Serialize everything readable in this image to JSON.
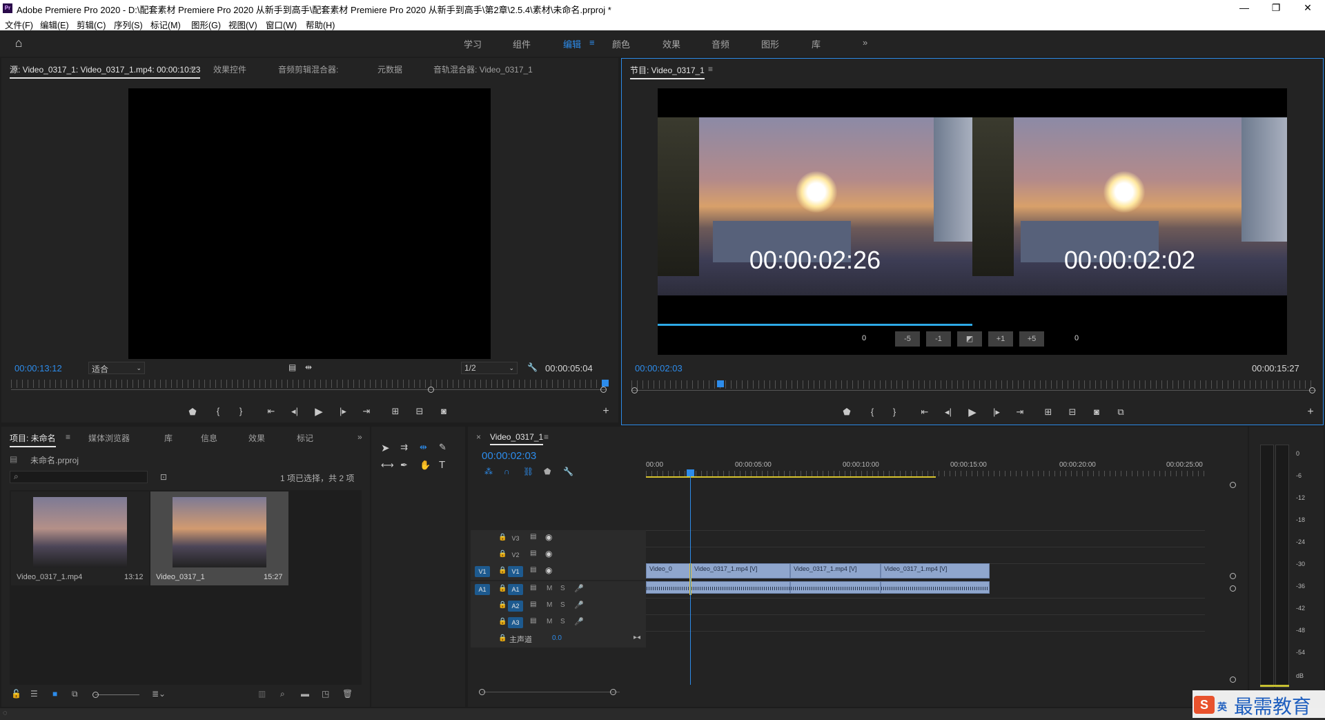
{
  "app": {
    "title": "Adobe Premiere Pro 2020 - D:\\配套素材 Premiere Pro 2020 从新手到高手\\配套素材 Premiere Pro 2020 从新手到高手\\第2章\\2.5.4\\素材\\未命名.prproj *",
    "logo": "Pr"
  },
  "window_controls": {
    "minimize": "—",
    "maximize": "❐",
    "close": "✕"
  },
  "menu": [
    "文件(F)",
    "编辑(E)",
    "剪辑(C)",
    "序列(S)",
    "标记(M)",
    "图形(G)",
    "视图(V)",
    "窗口(W)",
    "帮助(H)"
  ],
  "workspaces": {
    "items": [
      "学习",
      "组件",
      "编辑",
      "颜色",
      "效果",
      "音频",
      "图形",
      "库"
    ],
    "active": "编辑",
    "more": "»"
  },
  "source_panel": {
    "tabs": [
      "源: Video_0317_1: Video_0317_1.mp4: 00:00:10:23",
      "效果控件",
      "音频剪辑混合器:",
      "元数据",
      "音轨混合器: Video_0317_1"
    ],
    "timecode": "00:00:13:12",
    "fit": "适合",
    "resolution": "1/2",
    "duration": "00:00:05:04"
  },
  "program_panel": {
    "tab": "节目: Video_0317_1",
    "timecode": "00:00:02:03",
    "duration": "00:00:15:27",
    "trim": {
      "left_time": "00:00:02:26",
      "right_time": "00:00:02:02",
      "left_num": "0",
      "right_num": "0",
      "buttons": [
        "-5",
        "-1",
        "◩",
        "+1",
        "+5"
      ]
    }
  },
  "project_panel": {
    "tabs": [
      "项目: 未命名",
      "媒体浏览器",
      "库",
      "信息",
      "效果",
      "标记"
    ],
    "file": "未命名.prproj",
    "selection": "1 项已选择，共 2 项",
    "items": [
      {
        "name": "Video_0317_1.mp4",
        "duration": "13:12"
      },
      {
        "name": "Video_0317_1",
        "duration": "15:27"
      }
    ]
  },
  "timeline": {
    "tab": "Video_0317_1",
    "timecode": "00:00:02:03",
    "ruler": [
      "00:00",
      "00:00:05:00",
      "00:00:10:00",
      "00:00:15:00",
      "00:00:20:00",
      "00:00:25:00"
    ],
    "tracks": [
      "V3",
      "V2",
      "V1",
      "A1",
      "A2",
      "A3"
    ],
    "master": "主声道",
    "master_val": "0.0",
    "src_v": "V1",
    "src_a": "A1",
    "clips": [
      "Video_0",
      "Video_0317_1.mp4 [V]",
      "Video_0317_1.mp4 [V]",
      "Video_0317_1.mp4 [V]"
    ],
    "m": "M",
    "s": "S"
  },
  "meter": {
    "labels": [
      "0",
      "-6",
      "-12",
      "-18",
      "-24",
      "-30",
      "-36",
      "-42",
      "-48",
      "-54",
      "dB"
    ]
  },
  "watermark": {
    "ime": "英",
    "text": "最需教育"
  }
}
